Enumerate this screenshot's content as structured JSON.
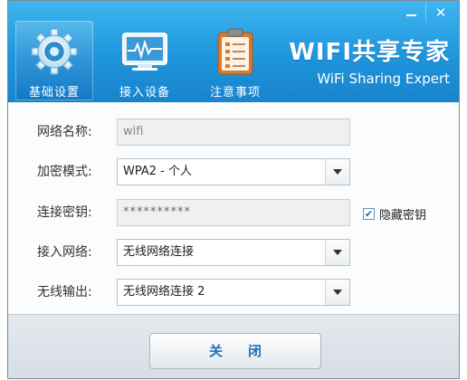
{
  "window": {
    "minimize_label": "",
    "close_glyph": "✕"
  },
  "nav": {
    "tabs": [
      {
        "label": "基础设置",
        "icon": "gear-icon",
        "active": true
      },
      {
        "label": "接入设备",
        "icon": "monitor-icon",
        "active": false
      },
      {
        "label": "注意事项",
        "icon": "clipboard-icon",
        "active": false
      }
    ]
  },
  "brand": {
    "title": "WIFI共享专家",
    "subtitle": "WiFi Sharing Expert"
  },
  "form": {
    "ssid": {
      "label": "网络名称:",
      "value": "wifi"
    },
    "encryption": {
      "label": "加密模式:",
      "value": "WPA2 - 个人"
    },
    "password": {
      "label": "连接密钥:",
      "value": "**********"
    },
    "hide_password": {
      "label": "隐藏密钥",
      "checked": true,
      "glyph": "✔"
    },
    "source_network": {
      "label": "接入网络:",
      "value": "无线网络连接"
    },
    "wireless_output": {
      "label": "无线输出:",
      "value": "无线网络连接 2"
    }
  },
  "footer": {
    "close_label": "关闭"
  },
  "colors": {
    "header_top": "#3fb6f0",
    "header_bottom": "#1784cd",
    "accent_text": "#1e6fbd"
  }
}
